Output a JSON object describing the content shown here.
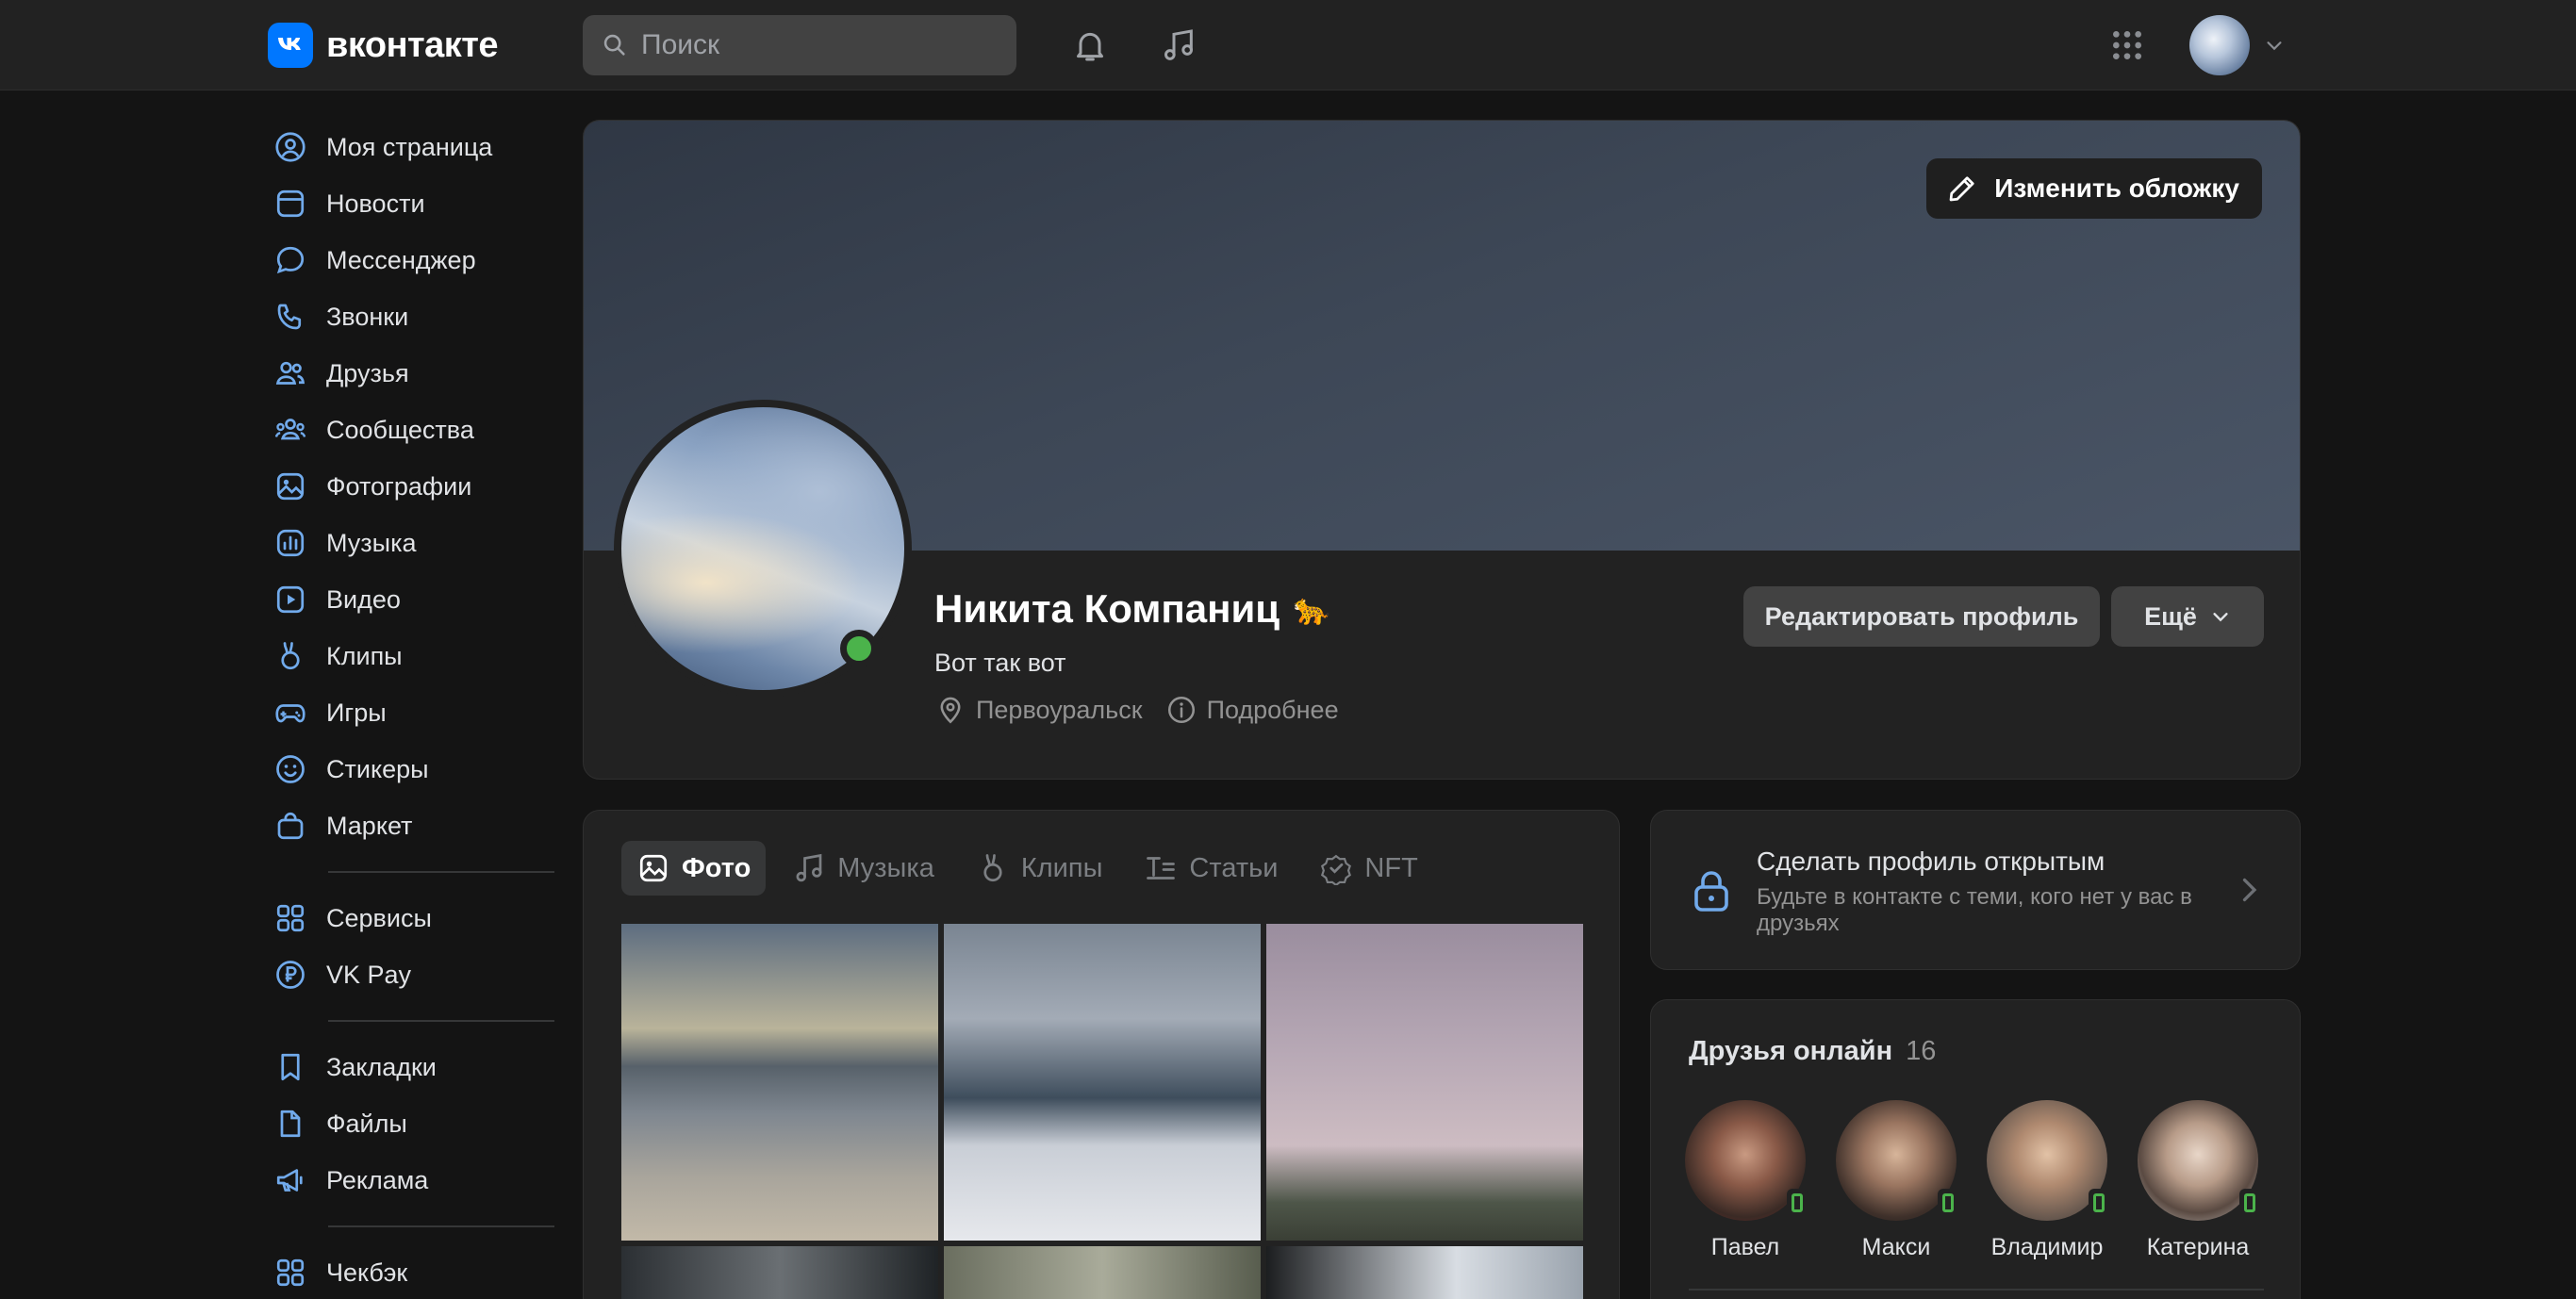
{
  "header": {
    "logo_text": "вконтакте",
    "search_placeholder": "Поиск",
    "icons": [
      "notifications-bell-icon",
      "music-note-icon",
      "apps-grid-icon",
      "chevron-down-icon"
    ]
  },
  "sidebar": {
    "groups": [
      [
        {
          "label": "Моя страница",
          "icon": "user-circle-icon"
        },
        {
          "label": "Новости",
          "icon": "newsfeed-icon"
        },
        {
          "label": "Мессенджер",
          "icon": "message-bubble-icon"
        },
        {
          "label": "Звонки",
          "icon": "phone-icon"
        },
        {
          "label": "Друзья",
          "icon": "friends-icon"
        },
        {
          "label": "Сообщества",
          "icon": "communities-icon"
        },
        {
          "label": "Фотографии",
          "icon": "photo-icon"
        },
        {
          "label": "Музыка",
          "icon": "music-icon"
        },
        {
          "label": "Видео",
          "icon": "video-icon"
        },
        {
          "label": "Клипы",
          "icon": "clips-icon"
        },
        {
          "label": "Игры",
          "icon": "gamepad-icon"
        },
        {
          "label": "Стикеры",
          "icon": "smile-icon"
        },
        {
          "label": "Маркет",
          "icon": "shopping-bag-icon"
        }
      ],
      [
        {
          "label": "Сервисы",
          "icon": "services-icon"
        },
        {
          "label": "VK Pay",
          "icon": "ruble-icon"
        }
      ],
      [
        {
          "label": "Закладки",
          "icon": "bookmark-icon"
        },
        {
          "label": "Файлы",
          "icon": "file-icon"
        },
        {
          "label": "Реклама",
          "icon": "megaphone-icon"
        }
      ],
      [
        {
          "label": "Чекбэк",
          "icon": "checkback-icon"
        }
      ]
    ]
  },
  "profile": {
    "cover_button": "Изменить обложку",
    "name": "Никита Компаниц",
    "name_emoji": "🐆",
    "status": "Вот так вот",
    "city": "Первоуральск",
    "more_info": "Подробнее",
    "edit_button": "Редактировать профиль",
    "more_button": "Ещё",
    "online": true
  },
  "media": {
    "tabs": [
      {
        "label": "Фото",
        "icon": "photo-icon",
        "active": true
      },
      {
        "label": "Музыка",
        "icon": "music-note-icon",
        "active": false
      },
      {
        "label": "Клипы",
        "icon": "clips-icon",
        "active": false
      },
      {
        "label": "Статьи",
        "icon": "article-icon",
        "active": false
      },
      {
        "label": "NFT",
        "icon": "nft-badge-icon",
        "active": false
      }
    ]
  },
  "privacy": {
    "title": "Сделать профиль открытым",
    "subtitle": "Будьте в контакте с теми, кого нет у вас в друзьях"
  },
  "friends": {
    "title": "Друзья онлайн",
    "count": "16",
    "list": [
      {
        "name": "Павел"
      },
      {
        "name": "Макси"
      },
      {
        "name": "Владимир"
      },
      {
        "name": "Катерина"
      }
    ]
  },
  "colors": {
    "accent": "#0077ff",
    "online": "#4bb34b",
    "background": "#141414",
    "card": "#222222"
  }
}
